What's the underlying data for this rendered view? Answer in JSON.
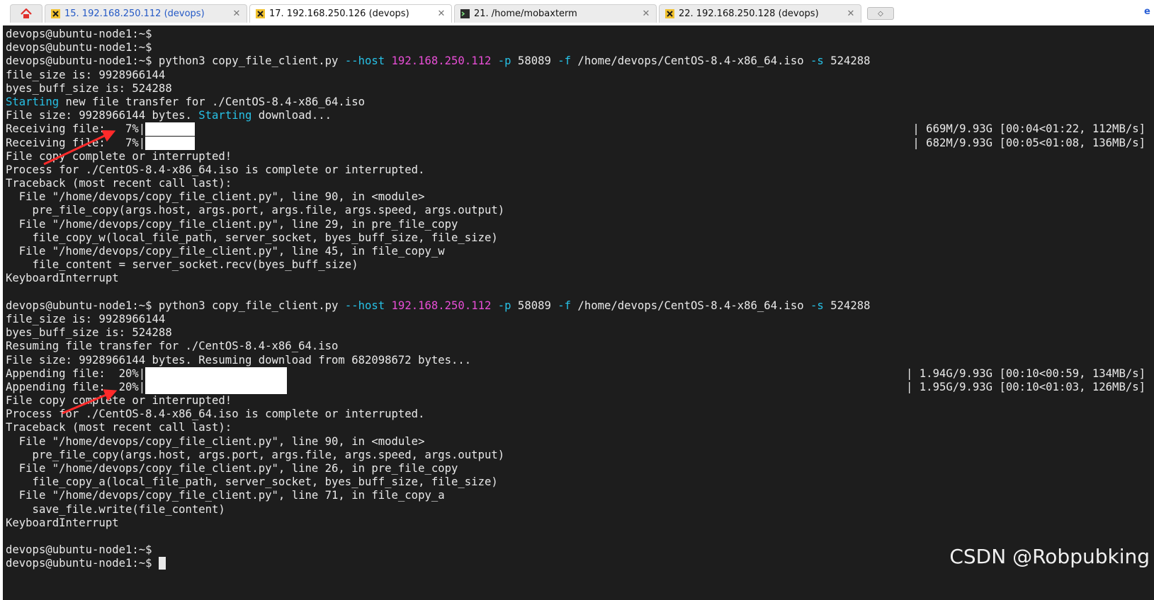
{
  "tabs": [
    {
      "label": "15. 192.168.250.112 (devops)",
      "close": "✕",
      "active": false,
      "icon": "ssh-icon"
    },
    {
      "label": "17. 192.168.250.126 (devops)",
      "close": "✕",
      "active": true,
      "icon": "ssh-icon"
    },
    {
      "label": "21. /home/mobaxterm",
      "close": "✕",
      "active": false,
      "icon": "terminal-icon"
    },
    {
      "label": "22. 192.168.250.128 (devops)",
      "close": "✕",
      "active": false,
      "icon": "ssh-icon"
    }
  ],
  "home_icon": "home-icon",
  "new_tab_icon": "plus-icon",
  "terminal": {
    "lines": [
      "devops@ubuntu-node1:~$",
      "devops@ubuntu-node1:~$",
      "devops@ubuntu-node1:~$ python3 copy_file_client.py --host 192.168.250.112 -p 58089 -f /home/devops/CentOS-8.4-x86_64.iso -s 524288",
      "file_size is: 9928966144",
      "byes_buff_size is: 524288",
      "Starting new file transfer for ./CentOS-8.4-x86_64.iso",
      "File size: 9928966144 bytes. Starting download...",
      "Receiving file:   7%|",
      "Receiving file:   7%|",
      "File copy complete or interrupted!",
      "Process for ./CentOS-8.4-x86_64.iso is complete or interrupted.",
      "Traceback (most recent call last):",
      "  File \"/home/devops/copy_file_client.py\", line 90, in <module>",
      "    pre_file_copy(args.host, args.port, args.file, args.speed, args.output)",
      "  File \"/home/devops/copy_file_client.py\", line 29, in pre_file_copy",
      "    file_copy_w(local_file_path, server_socket, byes_buff_size, file_size)",
      "  File \"/home/devops/copy_file_client.py\", line 45, in file_copy_w",
      "    file_content = server_socket.recv(byes_buff_size)",
      "KeyboardInterrupt",
      "",
      "devops@ubuntu-node1:~$ python3 copy_file_client.py --host 192.168.250.112 -p 58089 -f /home/devops/CentOS-8.4-x86_64.iso -s 524288",
      "file_size is: 9928966144",
      "byes_buff_size is: 524288",
      "Resuming file transfer for ./CentOS-8.4-x86_64.iso",
      "File size: 9928966144 bytes. Resuming download from 682098672 bytes...",
      "Appending file:  20%|",
      "Appending file:  20%|",
      "File copy complete or interrupted!",
      "Process for ./CentOS-8.4-x86_64.iso is complete or interrupted.",
      "Traceback (most recent call last):",
      "  File \"/home/devops/copy_file_client.py\", line 90, in <module>",
      "    pre_file_copy(args.host, args.port, args.file, args.speed, args.output)",
      "  File \"/home/devops/copy_file_client.py\", line 26, in pre_file_copy",
      "    file_copy_a(local_file_path, server_socket, byes_buff_size, file_size)",
      "  File \"/home/devops/copy_file_client.py\", line 71, in file_copy_a",
      "    save_file.write(file_content)",
      "KeyboardInterrupt",
      "",
      "devops@ubuntu-node1:~$",
      "devops@ubuntu-node1:~$ "
    ],
    "progress": [
      {
        "line": 7,
        "fraction": 0.07,
        "stat": "| 669M/9.93G [00:04<01:22, 112MB/s]"
      },
      {
        "line": 8,
        "fraction": 0.07,
        "stat": "| 682M/9.93G [00:05<01:08, 136MB/s]"
      },
      {
        "line": 25,
        "fraction": 0.2,
        "stat": "| 1.94G/9.93G [00:10<00:59, 134MB/s]"
      },
      {
        "line": 26,
        "fraction": 0.2,
        "stat": "| 1.95G/9.93G [00:10<01:03, 126MB/s]"
      }
    ],
    "highlight": {
      "cyan": [
        "--host",
        "-p",
        "-f",
        "-s",
        "Starting"
      ],
      "magenta": [
        "192.168.250.112"
      ]
    }
  },
  "watermark": "CSDN @Robpubking",
  "colors": {
    "terminal_bg": "#1d1d1d",
    "terminal_fg": "#e9e9e9",
    "option_color": "#27c1e6",
    "ip_color": "#e84ed6",
    "arrow_color": "#ff2a2a"
  }
}
